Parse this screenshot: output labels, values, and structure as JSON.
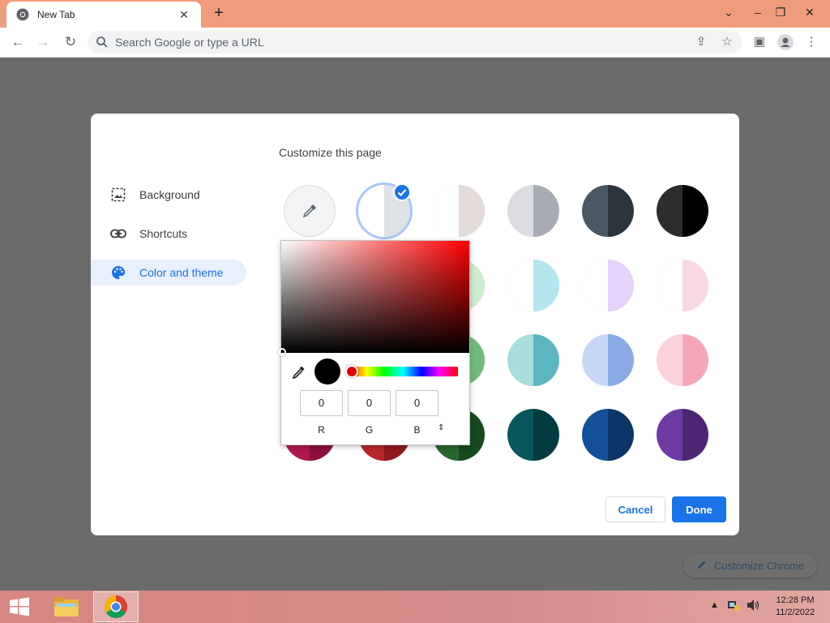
{
  "browser": {
    "tab_title": "New Tab",
    "omnibox_placeholder": "Search Google or type a URL"
  },
  "dialog": {
    "title": "Customize this page",
    "sidebar": [
      {
        "label": "Background",
        "icon": "image-icon"
      },
      {
        "label": "Shortcuts",
        "icon": "link-icon"
      },
      {
        "label": "Color and theme",
        "icon": "palette-icon",
        "active": true
      }
    ],
    "cancel_label": "Cancel",
    "done_label": "Done"
  },
  "color_picker": {
    "r": "0",
    "g": "0",
    "b": "0",
    "r_label": "R",
    "g_label": "G",
    "b_label": "B",
    "mode_toggle": "⇕",
    "preview_color": "#000000",
    "hue_color": "#ff0000"
  },
  "customize_chrome_label": "Customize Chrome",
  "taskbar": {
    "time": "12:28 PM",
    "date": "11/2/2022"
  },
  "colors": {
    "accent": "#1a73e8",
    "titlebar": "#ef9c7b"
  }
}
